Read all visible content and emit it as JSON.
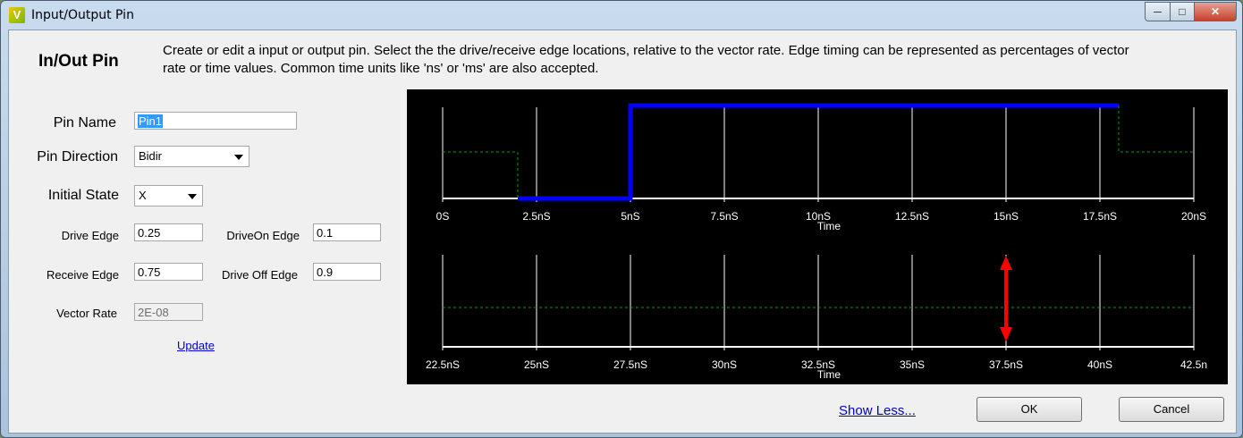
{
  "window": {
    "title": "Input/Output Pin"
  },
  "heading": "In/Out Pin",
  "description": "Create or edit a input or output pin.  Select the the drive/receive edge locations, relative to the vector rate.  Edge timing can be represented as percentages of vector rate or time values.  Common time units like 'ns' or 'ms' are also accepted.",
  "form": {
    "pin_name_label": "Pin Name",
    "pin_name_value": "Pin1",
    "pin_direction_label": "Pin Direction",
    "pin_direction_value": "Bidir",
    "initial_state_label": "Initial State",
    "initial_state_value": "X",
    "drive_edge_label": "Drive Edge",
    "drive_edge_value": "0.25",
    "driveon_edge_label": "DriveOn Edge",
    "driveon_edge_value": "0.1",
    "receive_edge_label": "Receive Edge",
    "receive_edge_value": "0.75",
    "driveoff_edge_label": "Drive Off Edge",
    "driveoff_edge_value": "0.9",
    "vector_rate_label": "Vector Rate",
    "vector_rate_value": "2E-08",
    "update_link": "Update"
  },
  "buttons": {
    "show_less": "Show Less...",
    "ok": "OK",
    "cancel": "Cancel"
  },
  "chart_data": [
    {
      "type": "line",
      "xlabel": "Time",
      "ticks": [
        "0S",
        "2.5nS",
        "5nS",
        "7.5nS",
        "10nS",
        "12.5nS",
        "15nS",
        "17.5nS",
        "20nS"
      ],
      "xlim_ns": [
        0,
        20
      ],
      "series": [
        {
          "color": "#0000ff",
          "style": "solid",
          "points_ns": [
            [
              2,
              0
            ],
            [
              5,
              0
            ],
            [
              5,
              1
            ],
            [
              18,
              1
            ]
          ]
        },
        {
          "color": "#00a000",
          "style": "dashed",
          "points_ns": [
            [
              0,
              0.5
            ],
            [
              2,
              0.5
            ],
            [
              2,
              0
            ]
          ]
        },
        {
          "color": "#00a000",
          "style": "dashed",
          "points_ns": [
            [
              18,
              1
            ],
            [
              18,
              0.5
            ],
            [
              20,
              0.5
            ]
          ]
        }
      ]
    },
    {
      "type": "line",
      "xlabel": "Time",
      "ticks": [
        "22.5nS",
        "25nS",
        "27.5nS",
        "30nS",
        "32.5nS",
        "35nS",
        "37.5nS",
        "40nS",
        "42.5n"
      ],
      "xlim_ns": [
        22.5,
        42.5
      ],
      "series": [
        {
          "color": "#00a000",
          "style": "dashed",
          "points_ns": [
            [
              22.5,
              0.5
            ],
            [
              42.5,
              0.5
            ]
          ]
        }
      ],
      "marker": {
        "color": "#ff0000",
        "x_ns": 37.5,
        "shape": "double-arrow"
      }
    }
  ]
}
